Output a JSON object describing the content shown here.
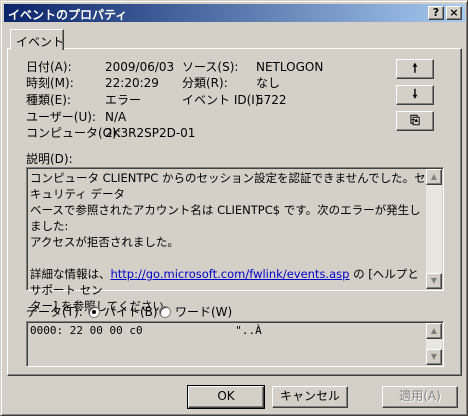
{
  "window": {
    "title": "イベントのプロパティ",
    "help_glyph": "?",
    "close_glyph": "×"
  },
  "tab": {
    "label": "イベント"
  },
  "fields": {
    "date_label": "日付(A):",
    "date_value": "2009/06/03",
    "time_label": "時刻(M):",
    "time_value": "22:20:29",
    "type_label": "種類(E):",
    "type_value": "エラー",
    "user_label": "ユーザー(U):",
    "user_value": "N/A",
    "computer_label": "コンピュータ(O):",
    "computer_value": "2K3R2SP2D-01",
    "source_label": "ソース(S):",
    "source_value": "NETLOGON",
    "category_label": "分類(R):",
    "category_value": "なし",
    "event_id_label": "イベント ID(I):",
    "event_id_value": "5722"
  },
  "nav_buttons": {
    "up_glyph": "🠕",
    "down_glyph": "🠗",
    "copy_glyph": "⎘"
  },
  "description": {
    "label": "説明(D):",
    "line1": "コンピュータ CLIENTPC からのセッション設定を認証できませんでした。セキュリティ データ",
    "line2": "ベースで参照されたアカウント名は CLIENTPC$ です。次のエラーが発生しました:",
    "line3": "アクセスが拒否されました。",
    "more_prefix": "詳細な情報は、",
    "link": "http://go.microsoft.com/fwlink/events.asp",
    "more_mid": " の [ヘルプとサポート セン",
    "more_line2": "ター] を参照してください。"
  },
  "data": {
    "label": "データ(T):",
    "option_bytes": "バイト(B)",
    "option_words": "ワード(W)",
    "selected": "bytes",
    "dump_line": "0000: 22 00 00 c0              \"..À"
  },
  "buttons": {
    "ok": "OK",
    "cancel": "キャンセル",
    "apply": "適用(A)"
  }
}
